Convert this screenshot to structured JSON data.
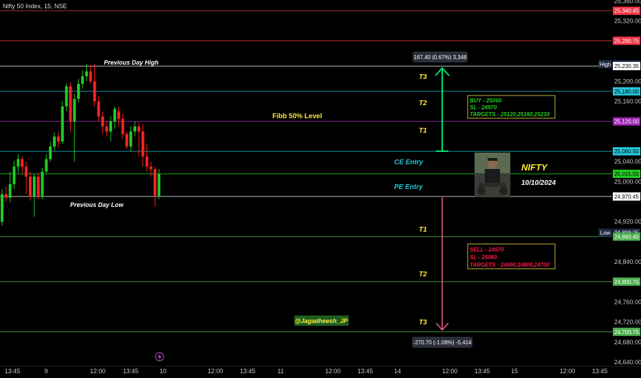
{
  "header": {
    "title": "Nifty 50 Index, 15, NSE"
  },
  "chart_data": {
    "type": "candlestick",
    "title": "Nifty 50 Index, 15, NSE",
    "ylim": [
      24632,
      25362
    ],
    "y_ticks": [
      "25,360.00",
      "25,320.00",
      "25,200.00",
      "25,160.00",
      "25,040.00",
      "25,000.00",
      "24,920.00",
      "24,840.00",
      "24,760.00",
      "24,720.00",
      "24,680.00",
      "24,640.00"
    ],
    "x_ticks": [
      "13:45",
      "9",
      "12:00",
      "13:45",
      "10",
      "12:00",
      "13:45",
      "11",
      "12:00",
      "13:45",
      "14",
      "12:00",
      "13:45",
      "15",
      "12:00",
      "13:45"
    ],
    "candles": [
      {
        "o": 24920,
        "c": 24975,
        "h": 24985,
        "l": 24912
      },
      {
        "o": 24975,
        "c": 24968,
        "h": 24990,
        "l": 24960
      },
      {
        "o": 24968,
        "c": 24995,
        "h": 25020,
        "l": 24958
      },
      {
        "o": 24995,
        "c": 25030,
        "h": 25042,
        "l": 24985
      },
      {
        "o": 25030,
        "c": 25045,
        "h": 25055,
        "l": 25018
      },
      {
        "o": 25045,
        "c": 25030,
        "h": 25050,
        "l": 25015
      },
      {
        "o": 25030,
        "c": 25010,
        "h": 25040,
        "l": 24975
      },
      {
        "o": 25010,
        "c": 24970,
        "h": 25020,
        "l": 24962
      },
      {
        "o": 24970,
        "c": 25010,
        "h": 25015,
        "l": 24930
      },
      {
        "o": 25010,
        "c": 24972,
        "h": 25018,
        "l": 24965
      },
      {
        "o": 24972,
        "c": 25020,
        "h": 25028,
        "l": 24965
      },
      {
        "o": 25020,
        "c": 25045,
        "h": 25055,
        "l": 25015
      },
      {
        "o": 25045,
        "c": 25070,
        "h": 25080,
        "l": 25040
      },
      {
        "o": 25070,
        "c": 25090,
        "h": 25098,
        "l": 25062
      },
      {
        "o": 25090,
        "c": 25080,
        "h": 25100,
        "l": 25068
      },
      {
        "o": 25080,
        "c": 25150,
        "h": 25160,
        "l": 25075
      },
      {
        "o": 25150,
        "c": 25190,
        "h": 25195,
        "l": 25140
      },
      {
        "o": 25190,
        "c": 25120,
        "h": 25198,
        "l": 25100
      },
      {
        "o": 25120,
        "c": 25165,
        "h": 25175,
        "l": 25040
      },
      {
        "o": 25165,
        "c": 25195,
        "h": 25205,
        "l": 25158
      },
      {
        "o": 25195,
        "c": 25210,
        "h": 25222,
        "l": 25185
      },
      {
        "o": 25210,
        "c": 25220,
        "h": 25235,
        "l": 25200
      },
      {
        "o": 25220,
        "c": 25200,
        "h": 25232,
        "l": 25195
      },
      {
        "o": 25200,
        "c": 25160,
        "h": 25235,
        "l": 25150
      },
      {
        "o": 25160,
        "c": 25130,
        "h": 25170,
        "l": 25120
      },
      {
        "o": 25130,
        "c": 25110,
        "h": 25140,
        "l": 25095
      },
      {
        "o": 25110,
        "c": 25100,
        "h": 25120,
        "l": 25090
      },
      {
        "o": 25100,
        "c": 25120,
        "h": 25130,
        "l": 25080
      },
      {
        "o": 25120,
        "c": 25145,
        "h": 25150,
        "l": 25105
      },
      {
        "o": 25140,
        "c": 25125,
        "h": 25150,
        "l": 25110
      },
      {
        "o": 25125,
        "c": 25095,
        "h": 25135,
        "l": 25085
      },
      {
        "o": 25095,
        "c": 25070,
        "h": 25100,
        "l": 25065
      },
      {
        "o": 25070,
        "c": 25100,
        "h": 25110,
        "l": 25060
      },
      {
        "o": 25100,
        "c": 25110,
        "h": 25120,
        "l": 25090
      },
      {
        "o": 25110,
        "c": 25100,
        "h": 25118,
        "l": 25050
      },
      {
        "o": 25100,
        "c": 25050,
        "h": 25115,
        "l": 25030
      },
      {
        "o": 25050,
        "c": 25030,
        "h": 25075,
        "l": 25020
      },
      {
        "o": 25030,
        "c": 25025,
        "h": 25040,
        "l": 25010
      },
      {
        "o": 25025,
        "c": 24972,
        "h": 25030,
        "l": 24950
      },
      {
        "o": 24972,
        "c": 25015,
        "h": 25025,
        "l": 24965
      }
    ],
    "up_color": "#22cc22",
    "down_color": "#ff2222"
  },
  "levels": [
    {
      "price": 25340.45,
      "label": "25,340.45",
      "color": "#f23645"
    },
    {
      "price": 25280.75,
      "label": "25,280.75",
      "color": "#f23645"
    },
    {
      "price": 25234.05,
      "label": "25,234.05",
      "tag": "High",
      "color": "#1e2a44"
    },
    {
      "price": 25230.35,
      "label": "25,230.35",
      "color": "#ffffff"
    },
    {
      "price": 25180.0,
      "label": "25,180.00",
      "color": "#26c6da"
    },
    {
      "price": 25120.0,
      "label": "25,120.00",
      "color": "#9c27b0"
    },
    {
      "price": 25060.5,
      "label": "25,060.50",
      "color": "#26c6da"
    },
    {
      "price": 25015.55,
      "label": "25,015.55",
      "color": "#22cc22"
    },
    {
      "price": 24970.45,
      "label": "24,970.45",
      "color": "#ffffff"
    },
    {
      "price": 24898.25,
      "label": "24,898.25",
      "tag": "Low",
      "color": "#1e2a44"
    },
    {
      "price": 24890.4,
      "label": "24,890.40",
      "color": "#4caf50"
    },
    {
      "price": 24800.75,
      "label": "24,800.75",
      "color": "#4caf50"
    },
    {
      "price": 24700.75,
      "label": "24,700.75",
      "color": "#4caf50"
    }
  ],
  "annotations": {
    "prev_high": "Previous Day High",
    "prev_low": "Previous Day Low",
    "fib": "Fibb 50% Level",
    "ce_entry": "CE Entry",
    "pe_entry": "PE Entry",
    "upper_t3": "T3",
    "upper_t2": "T2",
    "upper_t1": "T1",
    "lower_t1": "T1",
    "lower_t2": "T2",
    "lower_t3": "T3",
    "measure_up": "167.40 (0.67%) 3,348",
    "measure_down": "-270.70 (-1.08%) -5,414",
    "buy_box": [
      "BUY - 25060",
      "SL - 24970",
      "TARGETS - 25120,25180,25230"
    ],
    "sell_box": [
      "SELL - 24970",
      "SL - 25060",
      "TARGETS - 24890,24800,24700"
    ],
    "nifty": "NIFTY",
    "date": "10/10/2024",
    "handle": "@Jagadheesh_JP"
  }
}
